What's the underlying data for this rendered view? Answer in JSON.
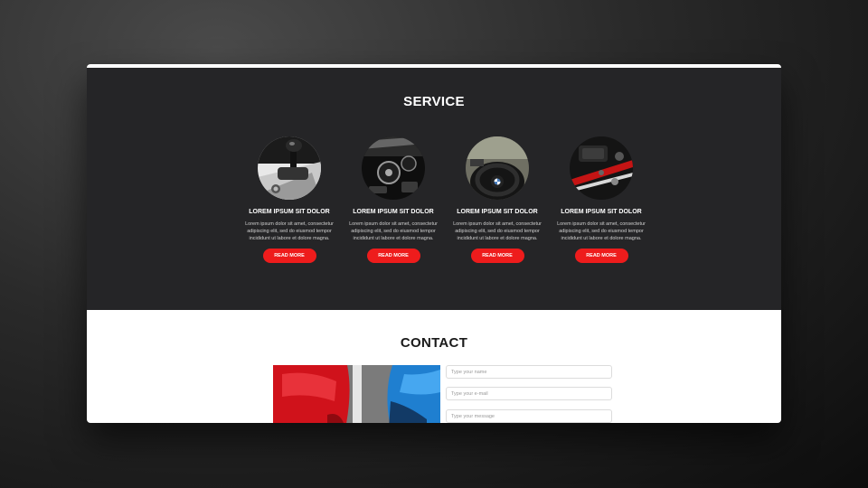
{
  "service": {
    "title": "SERVICE",
    "cards": [
      {
        "title": "LOREM IPSUM SIT DOLOR",
        "text": "Lorem ipsum dolor sit amet, consectetur adipiscing elit, sed do eiusmod tempor incididunt ut labore et dolore magna.",
        "button": "READ MORE",
        "image": "gear-shifter-photo"
      },
      {
        "title": "LOREM IPSUM SIT DOLOR",
        "text": "Lorem ipsum dolor sit amet, consectetur adipiscing elit, sed do eiusmod tempor incididunt ut labore et dolore magna.",
        "button": "READ MORE",
        "image": "gauge-cluster-photo"
      },
      {
        "title": "LOREM IPSUM SIT DOLOR",
        "text": "Lorem ipsum dolor sit amet, consectetur adipiscing elit, sed do eiusmod tempor incididunt ut labore et dolore magna.",
        "button": "READ MORE",
        "image": "steering-wheel-photo"
      },
      {
        "title": "LOREM IPSUM SIT DOLOR",
        "text": "Lorem ipsum dolor sit amet, consectetur adipiscing elit, sed do eiusmod tempor incididunt ut labore et dolore magna.",
        "button": "READ MORE",
        "image": "car-interior-photo"
      }
    ]
  },
  "contact": {
    "title": "CONTACT",
    "image": "parked-cars-photo",
    "name_placeholder": "Type your name",
    "email_placeholder": "Type your e-mail",
    "message_placeholder": "Type your message"
  },
  "colors": {
    "service_bg": "#252527",
    "accent_red": "#ee1c1c",
    "page_bg": "#ffffff"
  }
}
